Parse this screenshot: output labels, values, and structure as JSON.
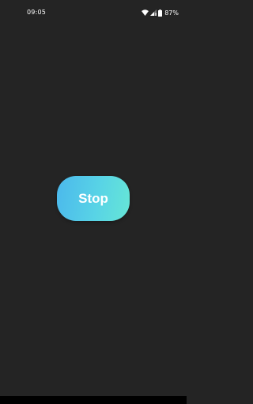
{
  "status_bar": {
    "time": "09:05",
    "battery_percent": "87%",
    "icons": [
      "wifi-icon",
      "signal-icon",
      "battery-icon"
    ]
  },
  "main": {
    "stop_label": "Stop"
  },
  "colors": {
    "background": "#242424",
    "button_gradient_start": "#4bb8ec",
    "button_gradient_end": "#66e6d6",
    "text": "#ffffff"
  }
}
